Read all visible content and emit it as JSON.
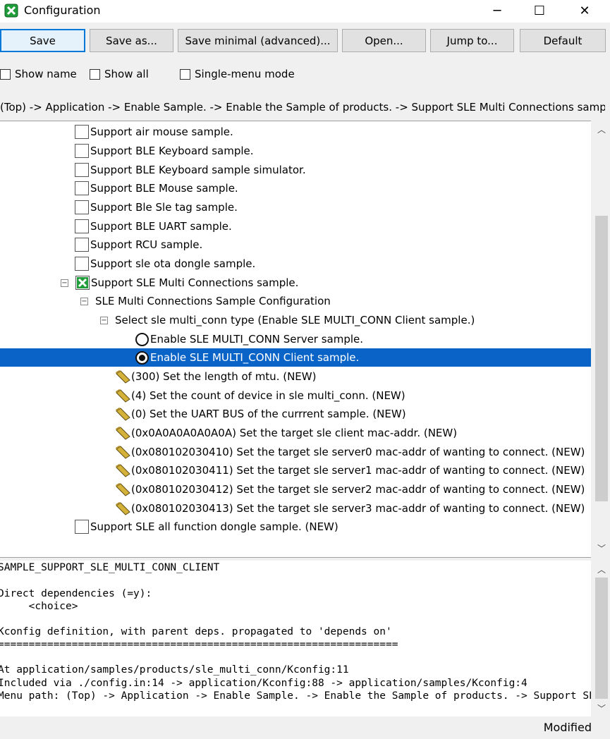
{
  "window": {
    "title": "Configuration",
    "minimize_glyph": "─",
    "maximize_glyph": "☐",
    "close_glyph": "✕",
    "icon": "kconfig-app-icon",
    "accent_color": "#0a64c8"
  },
  "toolbar": {
    "save": "Save",
    "save_as": "Save as...",
    "save_minimal": "Save minimal (advanced)...",
    "open": "Open...",
    "jump_to": "Jump to...",
    "default": "Default"
  },
  "options": {
    "show_name": "Show name",
    "show_all": "Show all",
    "single_menu": "Single-menu mode"
  },
  "breadcrumb": "(Top) -> Application -> Enable Sample. -> Enable the Sample of products. -> Support SLE Multi Connections sample.",
  "tree": {
    "items": [
      {
        "label": "Support air mouse sample."
      },
      {
        "label": "Support BLE Keyboard sample."
      },
      {
        "label": "Support BLE Keyboard sample simulator."
      },
      {
        "label": "Support BLE Mouse sample."
      },
      {
        "label": "Support Ble Sle tag sample."
      },
      {
        "label": "Support BLE UART sample."
      },
      {
        "label": "Support RCU sample."
      },
      {
        "label": "Support sle ota dongle sample."
      },
      {
        "label": "Support SLE Multi Connections sample."
      },
      {
        "label": "SLE Multi Connections Sample Configuration"
      },
      {
        "label": "Select sle multi_conn type (Enable SLE MULTI_CONN Client sample.)"
      },
      {
        "label": "Enable SLE MULTI_CONN Server sample."
      },
      {
        "label": "Enable SLE MULTI_CONN Client sample."
      },
      {
        "label": "(300) Set the length of mtu. (NEW)"
      },
      {
        "label": "(4) Set the count of device in sle multi_conn. (NEW)"
      },
      {
        "label": "(0) Set the UART BUS of the currrent sample. (NEW)"
      },
      {
        "label": "(0x0A0A0A0A0A0A) Set the target sle client mac-addr. (NEW)"
      },
      {
        "label": "(0x080102030410) Set the target sle server0 mac-addr of wanting to connect. (NEW)"
      },
      {
        "label": "(0x080102030411) Set the target sle server1 mac-addr of wanting to connect. (NEW)"
      },
      {
        "label": "(0x080102030412) Set the target sle server2 mac-addr of wanting to connect. (NEW)"
      },
      {
        "label": "(0x080102030413) Set the target sle server3 mac-addr of wanting to connect. (NEW)"
      },
      {
        "label": "Support SLE all function dongle sample. (NEW)"
      }
    ]
  },
  "info": {
    "lines": [
      "SAMPLE_SUPPORT_SLE_MULTI_CONN_CLIENT",
      "",
      "Direct dependencies (=y):",
      "     <choice>",
      "",
      "Kconfig definition, with parent deps. propagated to 'depends on'",
      "=================================================================",
      "",
      "At application/samples/products/sle_multi_conn/Kconfig:11",
      "Included via ./config.in:14 -> application/Kconfig:88 -> application/samples/Kconfig:4",
      "Menu path: (Top) -> Application -> Enable Sample. -> Enable the Sample of products. -> Support SLE Multi Connections sample."
    ]
  },
  "status": "Modified"
}
